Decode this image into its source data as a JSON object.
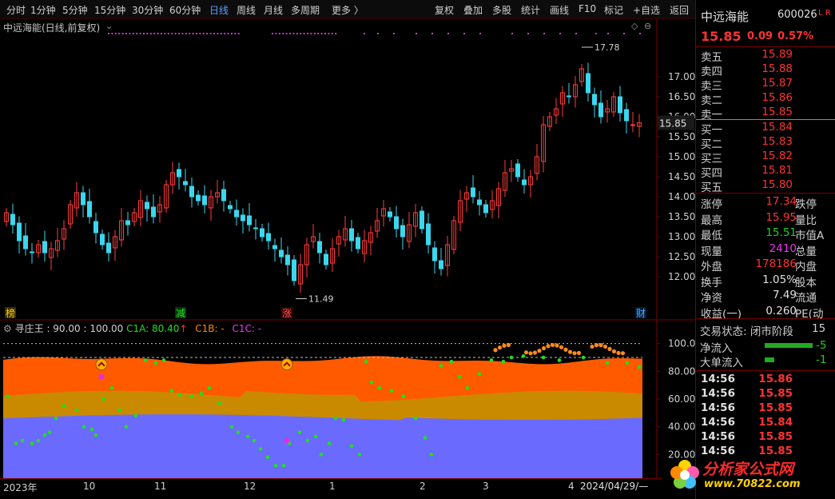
{
  "toolbar": {
    "left": [
      "分时",
      "1分钟",
      "5分钟",
      "15分钟",
      "30分钟",
      "60分钟",
      "日线",
      "周线",
      "月线",
      "多周期",
      "更多 〉"
    ],
    "active": "日线",
    "right": [
      "复权",
      "叠加",
      "多股",
      "统计",
      "画线",
      "F10",
      "标记",
      "+自选",
      "返回"
    ]
  },
  "chart": {
    "title": "中远海能(日线,前复权)",
    "price_axis": [
      "17.00",
      "16.50",
      "16.00",
      "15.50",
      "15.00",
      "14.50",
      "14.00",
      "13.50",
      "13.00",
      "12.50",
      "12.00"
    ],
    "current_price_tag": "15.85",
    "high_label": "17.78",
    "low_label": "11.49",
    "markers": {
      "m1": "榜",
      "m2": "减",
      "m3": "涨",
      "m4": "财"
    },
    "ind_axis": [
      "100.0",
      "80.00",
      "60.00",
      "40.00",
      "20.00"
    ],
    "indicator": {
      "name": "寻庄王",
      "params": ": 90.00 : 100.00",
      "c1a": "C1A: 80.40",
      "c1a_arrow": "↑",
      "c1b": "C1B: -",
      "c1c": "C1C: -"
    },
    "xaxis": [
      "2023年",
      "10",
      "11",
      "12",
      "1",
      "2",
      "3",
      "4",
      "2024/04/29/—"
    ]
  },
  "chart_data": {
    "type": "candlestick",
    "ylim": [
      11.2,
      18.0
    ],
    "closes": [
      13.6,
      13.3,
      12.9,
      12.7,
      12.6,
      12.8,
      12.6,
      12.7,
      12.9,
      13.2,
      13.8,
      14.1,
      13.8,
      13.5,
      13.1,
      12.8,
      12.6,
      13.0,
      13.4,
      13.3,
      13.6,
      13.9,
      13.7,
      13.5,
      13.8,
      14.3,
      14.6,
      14.5,
      14.3,
      14.0,
      13.9,
      13.8,
      14.0,
      14.1,
      13.9,
      13.7,
      13.5,
      13.4,
      13.3,
      13.2,
      13.0,
      12.9,
      12.7,
      12.5,
      12.3,
      11.9,
      12.3,
      12.8,
      13.0,
      12.6,
      12.3,
      12.7,
      13.0,
      13.2,
      12.9,
      12.7,
      12.9,
      13.1,
      13.4,
      13.7,
      13.5,
      13.2,
      13.0,
      13.3,
      13.6,
      13.2,
      12.8,
      12.4,
      12.2,
      12.8,
      13.4,
      13.9,
      14.1,
      14.0,
      13.8,
      13.6,
      13.9,
      14.2,
      14.6,
      14.7,
      14.5,
      14.3,
      14.5,
      15.0,
      15.8,
      16.0,
      16.2,
      16.6,
      16.5,
      16.8,
      17.2,
      16.6,
      16.3,
      16.0,
      16.2,
      16.5,
      16.1,
      15.9,
      15.8,
      15.85
    ],
    "indicator_series": [
      "C1A",
      "C1B",
      "C1C"
    ]
  },
  "panel": {
    "name": "中远海能",
    "code": "600026",
    "flags": "L R",
    "price": "15.85",
    "chg": "0.09",
    "pct": "0.57%",
    "asks": [
      {
        "l": "卖五",
        "p": "15.89"
      },
      {
        "l": "卖四",
        "p": "15.88"
      },
      {
        "l": "卖三",
        "p": "15.87"
      },
      {
        "l": "卖二",
        "p": "15.86"
      },
      {
        "l": "卖一",
        "p": "15.85"
      }
    ],
    "bids": [
      {
        "l": "买一",
        "p": "15.84"
      },
      {
        "l": "买二",
        "p": "15.83"
      },
      {
        "l": "买三",
        "p": "15.82"
      },
      {
        "l": "买四",
        "p": "15.81"
      },
      {
        "l": "买五",
        "p": "15.80"
      }
    ],
    "stats": [
      {
        "l": "涨停",
        "v": "17.34",
        "c": "red",
        "r": "跌停"
      },
      {
        "l": "最高",
        "v": "15.95",
        "c": "red",
        "r": "量比"
      },
      {
        "l": "最低",
        "v": "15.51",
        "c": "green",
        "r": "市值A"
      },
      {
        "l": "现量",
        "v": "2410",
        "c": "mag",
        "r": "总量"
      },
      {
        "l": "外盘",
        "v": "178186",
        "c": "red",
        "r": "内盘"
      },
      {
        "l": "换手",
        "v": "1.05%",
        "c": "white",
        "r": "股本"
      },
      {
        "l": "净资",
        "v": "7.49",
        "c": "white",
        "r": "流通"
      },
      {
        "l": "收益(一)",
        "v": "0.260",
        "c": "white",
        "r": "PE(动"
      }
    ],
    "trade_state": "交易状态: 闭市阶段",
    "trade_state_num": "15",
    "flows": [
      {
        "l": "净流入",
        "v": "-5"
      },
      {
        "l": "大单流入",
        "v": "-1"
      }
    ],
    "ticks": [
      {
        "t": "14:56",
        "p": "15.86"
      },
      {
        "t": "14:56",
        "p": "15.85"
      },
      {
        "t": "14:56",
        "p": "15.85"
      },
      {
        "t": "14:56",
        "p": "15.84"
      },
      {
        "t": "14:56",
        "p": "15.85"
      },
      {
        "t": "14:56",
        "p": "15.85"
      }
    ]
  },
  "watermark": {
    "text": "分析家公式网",
    "url": "www.70822.com"
  },
  "colors": {
    "up": "#ff3b3b",
    "down": "#3ad7ee",
    "band_orange": "#ff5a00",
    "band_gold": "#c98a00",
    "band_blue": "#6a6aff",
    "dots": "#22dd22",
    "magenta": "#e030e0",
    "grid": "#7a0000"
  }
}
